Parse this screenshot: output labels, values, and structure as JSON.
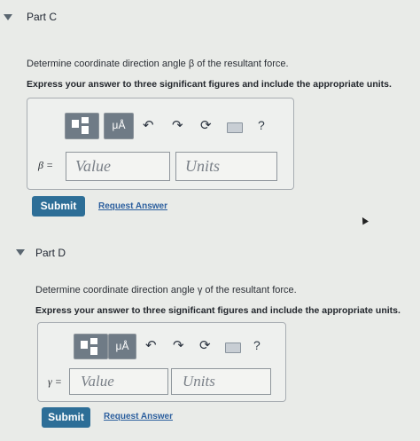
{
  "partC": {
    "title": "Part C",
    "question": "Determine coordinate direction angle β of the resultant force.",
    "instruction": "Express your answer to three significant figures and include the appropriate units.",
    "toolbar": {
      "units_label": "μÅ",
      "help": "?"
    },
    "answer_label": "β =",
    "value_placeholder": "Value",
    "units_placeholder": "Units",
    "submit": "Submit",
    "request": "Request Answer"
  },
  "partD": {
    "title": "Part D",
    "question": "Determine coordinate direction angle γ of the resultant force.",
    "instruction": "Express your answer to three significant figures and include the appropriate units.",
    "toolbar": {
      "units_label": "μÅ",
      "help": "?"
    },
    "answer_label": "γ =",
    "value_placeholder": "Value",
    "units_placeholder": "Units",
    "submit": "Submit",
    "request": "Request Answer"
  }
}
